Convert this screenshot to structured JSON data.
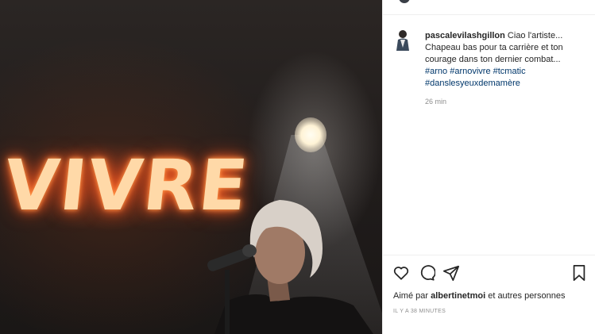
{
  "photo": {
    "neon_text": "VIVRE"
  },
  "comment": {
    "username": "pascalevilashgillon",
    "text_line1": " Ciao l'artiste...",
    "text_line2": "Chapeau bas pour ta carrière et ton",
    "text_line3": "courage dans ton dernier combat...",
    "hashtags_line1": [
      "#arno",
      "#arnovivre",
      "#tcmatic"
    ],
    "hashtags_line2": [
      "#danslesyeuxdemamère"
    ],
    "time": "26 min"
  },
  "actions": {
    "icons": [
      "heart-icon",
      "comment-icon",
      "share-icon",
      "bookmark-icon"
    ]
  },
  "likes": {
    "prefix": "Aimé par ",
    "user": "albertinetmoi",
    "suffix": " et autres personnes"
  },
  "timestamp": "IL Y A 38 MINUTES"
}
